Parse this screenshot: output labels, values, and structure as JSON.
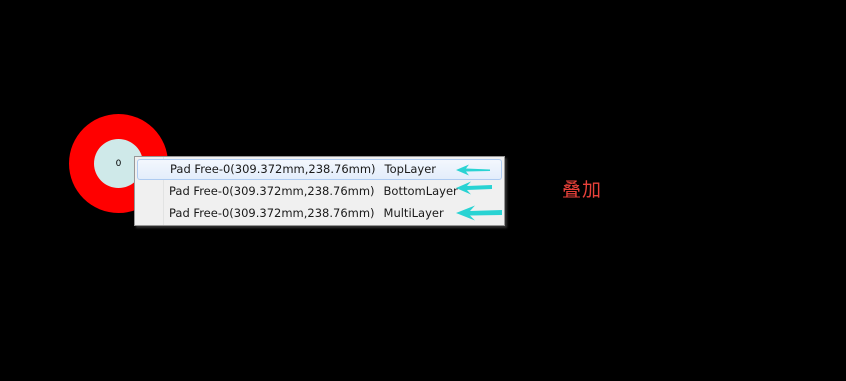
{
  "pad": {
    "designator": "0"
  },
  "context_menu": {
    "items": [
      {
        "label": "Pad Free-0(309.372mm,238.76mm)",
        "layer": "TopLayer"
      },
      {
        "label": "Pad Free-0(309.372mm,238.76mm)",
        "layer": "BottomLayer"
      },
      {
        "label": "Pad Free-0(309.372mm,238.76mm)",
        "layer": "MultiLayer"
      }
    ]
  },
  "annotation": {
    "text": "叠加"
  },
  "colors": {
    "background": "#000000",
    "pad_copper": "#ff0000",
    "pad_hole": "#cfe9e9",
    "arrow": "#29d3d3",
    "annotation_text": "#e8413a",
    "menu_highlight_border": "#aecbf1"
  },
  "icons": {
    "pointer_arrow": "arrow-left-icon"
  }
}
